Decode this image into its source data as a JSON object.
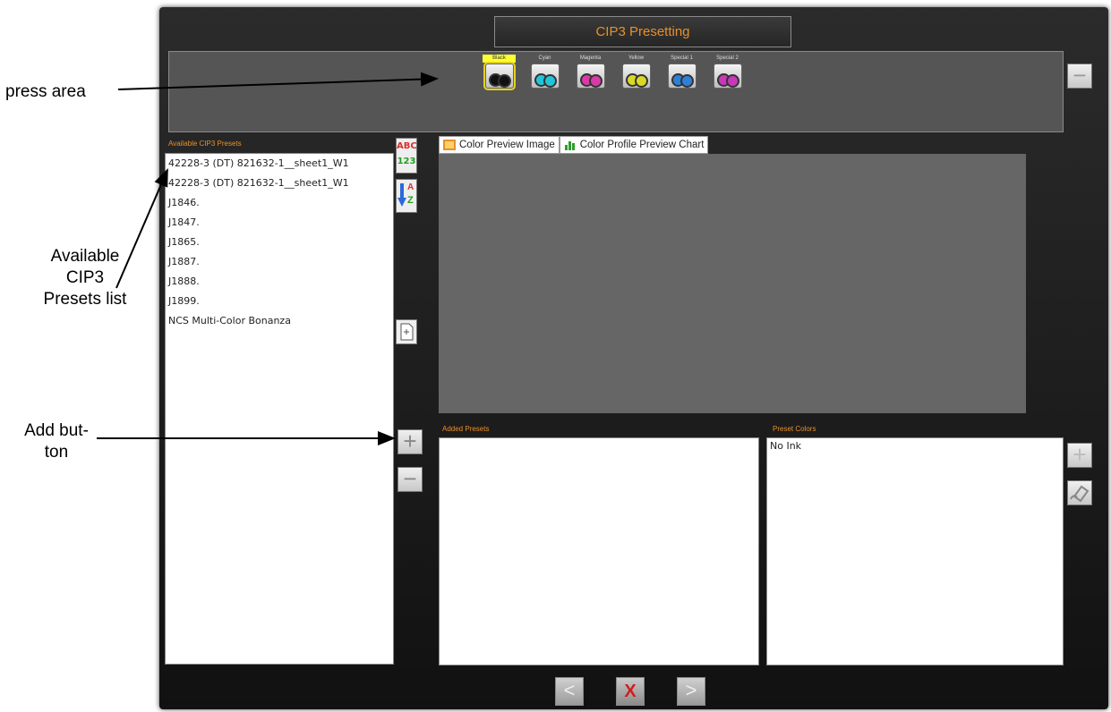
{
  "annotations": {
    "press_area": "press area",
    "available_list": [
      "Available",
      "CIP3",
      "Presets list"
    ],
    "add_button": [
      "Add but-",
      "ton"
    ]
  },
  "app": {
    "title": "CIP3 Presetting",
    "units": [
      {
        "label": "Black",
        "selected": true,
        "color": "#111111"
      },
      {
        "label": "Cyan",
        "selected": false,
        "color": "#22c4d8"
      },
      {
        "label": "Magenta",
        "selected": false,
        "color": "#d83aa6"
      },
      {
        "label": "Yellow",
        "selected": false,
        "color": "#d8d826"
      },
      {
        "label": "Special 1",
        "selected": false,
        "color": "#2e7fd8"
      },
      {
        "label": "Special 2",
        "selected": false,
        "color": "#c838b8"
      }
    ],
    "available_header": "Available CIP3 Presets",
    "available_presets": [
      "42228-3 (DT) 821632-1__sheet1_W1",
      "42228-3 (DT) 821632-1__sheet1_W1",
      "J1846.",
      "J1847.",
      "J1865.",
      "J1887.",
      "J1888.",
      "J1899.",
      "NCS Multi-Color Bonanza"
    ],
    "sort_abc_top": "ABC",
    "sort_abc_bottom": "123",
    "sort_az_a": "A",
    "sort_az_z": "Z",
    "tabs": [
      "Color Preview Image",
      "Color Profile Preview Chart"
    ],
    "added_header": "Added Presets",
    "colors_header": "Preset Colors",
    "preset_colors": [
      "No Ink"
    ],
    "add_symbol": "+",
    "remove_symbol": "−",
    "nav_prev": "<",
    "nav_next": ">",
    "nav_cancel": "X"
  }
}
